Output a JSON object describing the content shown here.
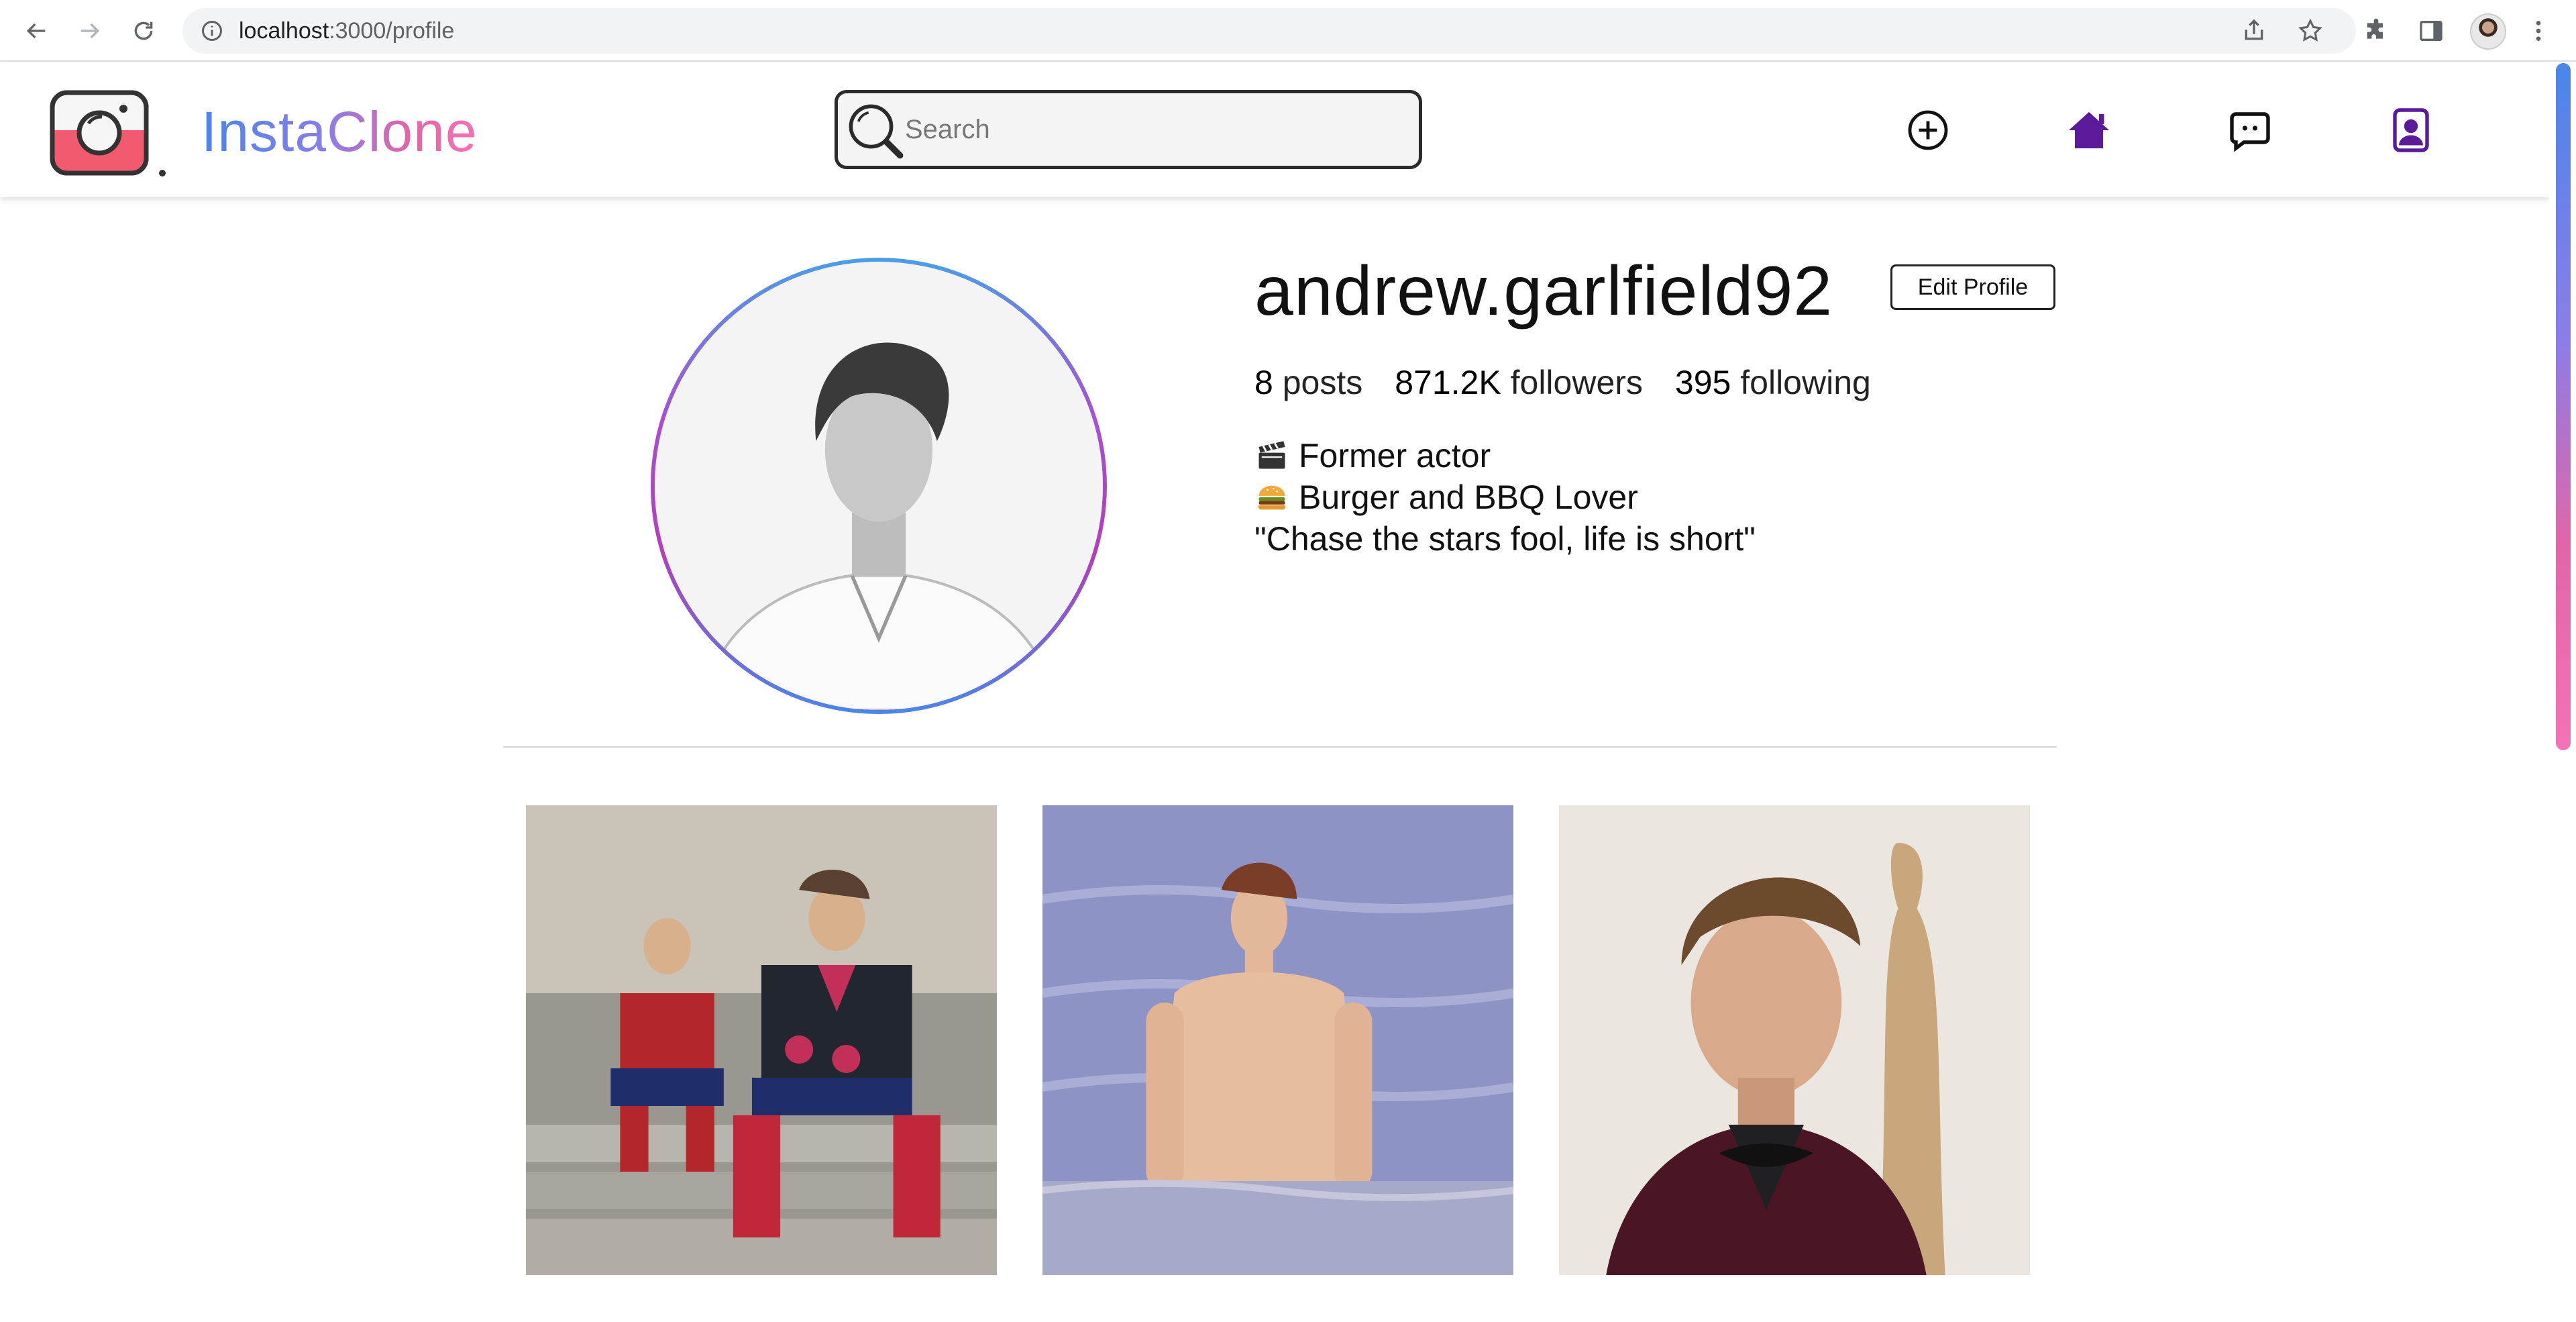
{
  "browser": {
    "url_host": "localhost",
    "url_path": ":3000/profile"
  },
  "header": {
    "brand": "InstaClone",
    "search_placeholder": "Search",
    "colors": {
      "brand_blue": "#4a86e8",
      "brand_pink": "#f472b6",
      "nav_purple": "#5b1a9a"
    }
  },
  "profile": {
    "username": "andrew.garlfield92",
    "edit_label": "Edit Profile",
    "stats": {
      "posts_count": "8",
      "posts_label": "posts",
      "followers_count": "871.2K",
      "followers_label": "followers",
      "following_count": "395",
      "following_label": "following"
    },
    "bio": [
      {
        "icon": "clapperboard-icon",
        "text": "Former actor"
      },
      {
        "icon": "burger-icon",
        "text": "Burger and BBQ Lover"
      },
      {
        "text": "\"Chase the stars fool, life is short\""
      }
    ]
  },
  "posts": [
    {
      "icon": "photo-spiderman-steps"
    },
    {
      "icon": "photo-water"
    },
    {
      "icon": "photo-portrait"
    }
  ]
}
